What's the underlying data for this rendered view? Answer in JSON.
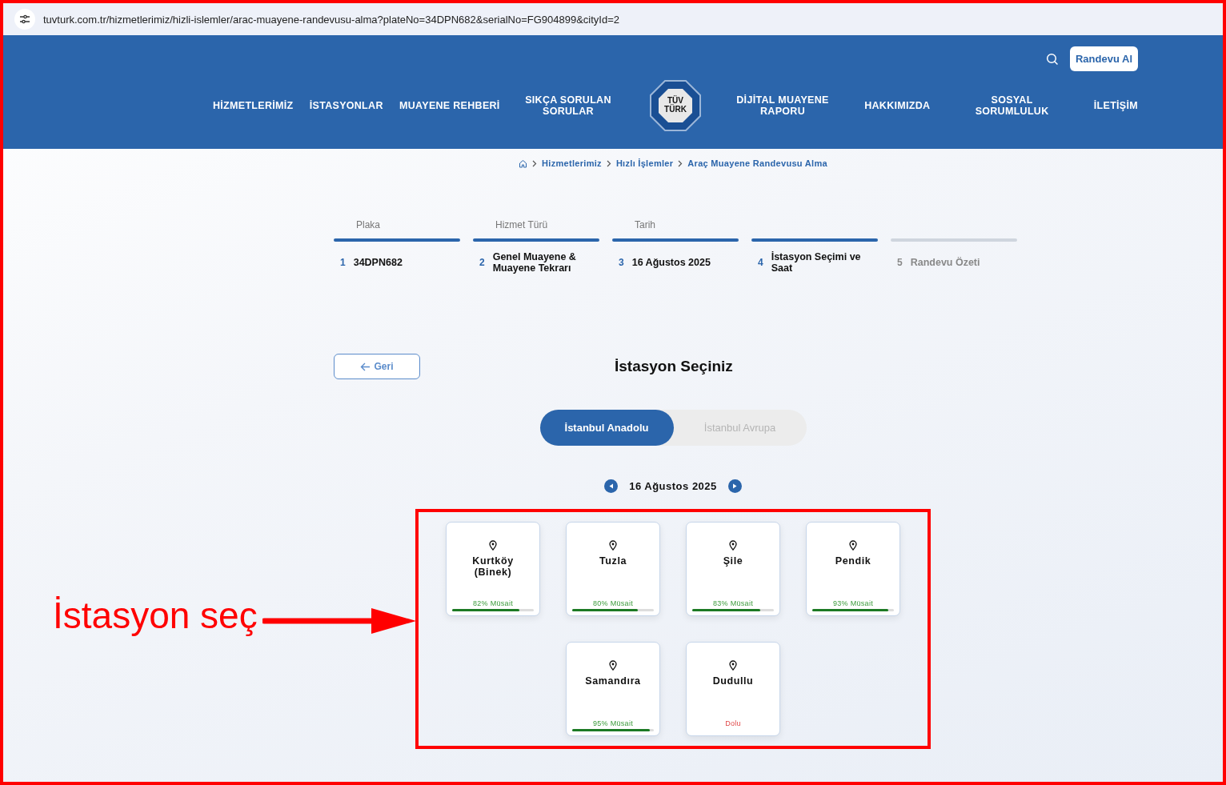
{
  "browser": {
    "url": "tuvturk.com.tr/hizmetlerimiz/hizli-islemler/arac-muayene-randevusu-alma?plateNo=34DPN682&serialNo=FG904899&cityId=2"
  },
  "header": {
    "cta": "Randevu Al",
    "logo": "TÜV TÜRK",
    "nav_left": [
      "HİZMETLERİMİZ",
      "İSTASYONLAR",
      "MUAYENE REHBERİ",
      "SIKÇA SORULAN SORULAR"
    ],
    "nav_right": [
      "DİJİTAL MUAYENE RAPORU",
      "HAKKIMIZDA",
      "SOSYAL SORUMLULUK",
      "İLETİŞİM"
    ]
  },
  "breadcrumb": [
    "Hizmetlerimiz",
    "Hızlı İşlemler",
    "Araç Muayene Randevusu Alma"
  ],
  "steps": [
    {
      "label": "Plaka",
      "number": "1",
      "value": "34DPN682",
      "done": true
    },
    {
      "label": "Hizmet Türü",
      "number": "2",
      "value": "Genel Muayene & Muayene Tekrarı",
      "done": true
    },
    {
      "label": "Tarih",
      "number": "3",
      "value": "16 Ağustos 2025",
      "done": true
    },
    {
      "number": "4",
      "value": "İstasyon Seçimi ve Saat",
      "done": true
    },
    {
      "number": "5",
      "value": "Randevu Özeti",
      "done": false
    }
  ],
  "back_button": "Geri",
  "title": "İstasyon Seçiniz",
  "regions": [
    {
      "label": "İstanbul Anadolu",
      "selected": true
    },
    {
      "label": "İstanbul Avrupa",
      "selected": false
    }
  ],
  "date": "16 Ağustos 2025",
  "stations": [
    {
      "name": "Kurtköy (Binek)",
      "kind": "available",
      "reading": "82% Müsait",
      "level": 0.82
    },
    {
      "name": "Tuzla",
      "kind": "available",
      "reading": "80% Müsait",
      "level": 0.8
    },
    {
      "name": "Şile",
      "kind": "available",
      "reading": "83% Müsait",
      "level": 0.83
    },
    {
      "name": "Pendik",
      "kind": "available",
      "reading": "93% Müsait",
      "level": 0.93
    },
    {
      "name": "Samandıra",
      "kind": "available",
      "reading": "95% Müsait",
      "level": 0.95
    },
    {
      "name": "Dudullu",
      "kind": "full",
      "reading": "Dolu"
    }
  ],
  "annotation": {
    "text": "İstasyon seç"
  }
}
